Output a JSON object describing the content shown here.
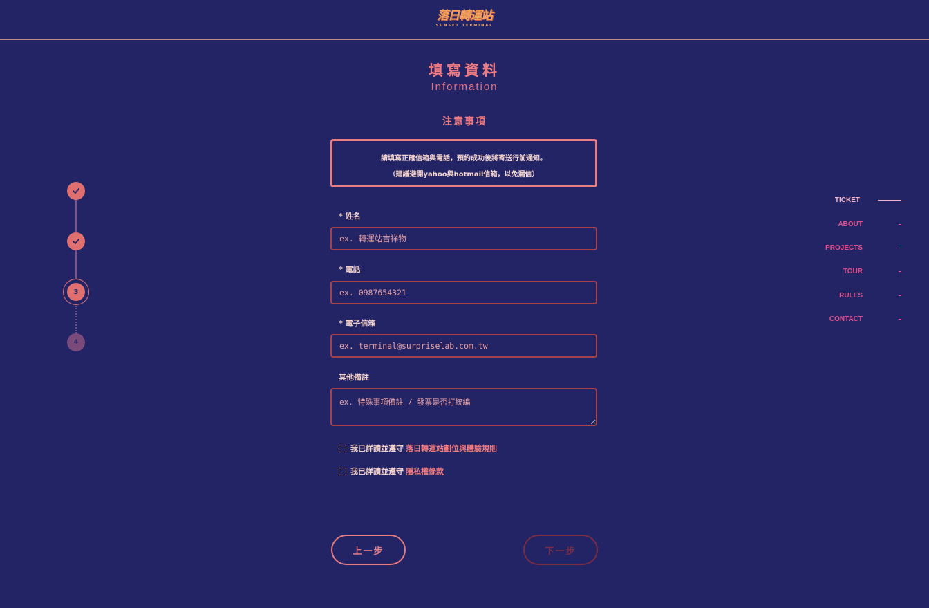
{
  "header": {
    "logo_text": "落日轉運站",
    "logo_subtext": "SUNSET TERMINAL"
  },
  "page": {
    "title_zh": "填寫資料",
    "title_en": "Information",
    "notice_heading": "注意事項",
    "notice_lines": [
      "請填寫正確信箱與電話，預約成功後將寄送行前通知。",
      "（建議避開yahoo與hotmail信箱，以免漏信）"
    ]
  },
  "form": {
    "name": {
      "label": "* 姓名",
      "placeholder": "ex. 轉運站吉祥物"
    },
    "phone": {
      "label": "* 電話",
      "placeholder": "ex. 0987654321"
    },
    "email": {
      "label": "* 電子信箱",
      "placeholder": "ex. terminal@surpriselab.com.tw"
    },
    "notes": {
      "label": "其他備註",
      "placeholder": "ex. 特殊事項備註 / 發票是否打統編"
    },
    "agree_rules": {
      "prefix": "我已詳讀並遵守",
      "link": "落日轉運站劃位與體驗規則"
    },
    "agree_privacy": {
      "prefix": "我已詳讀並遵守",
      "link": "隱私權條款"
    }
  },
  "buttons": {
    "prev": "上一步",
    "next": "下一步"
  },
  "stepper": {
    "current": "3",
    "future": "4"
  },
  "nav": {
    "items": [
      "TICKET",
      "ABOUT",
      "PROJECTS",
      "TOUR",
      "RULES",
      "CONTACT"
    ],
    "active": "TICKET"
  },
  "colors": {
    "background": "#222466",
    "accent": "#f07b80",
    "logo": "#f4a35c",
    "nav": "#e0508a"
  }
}
